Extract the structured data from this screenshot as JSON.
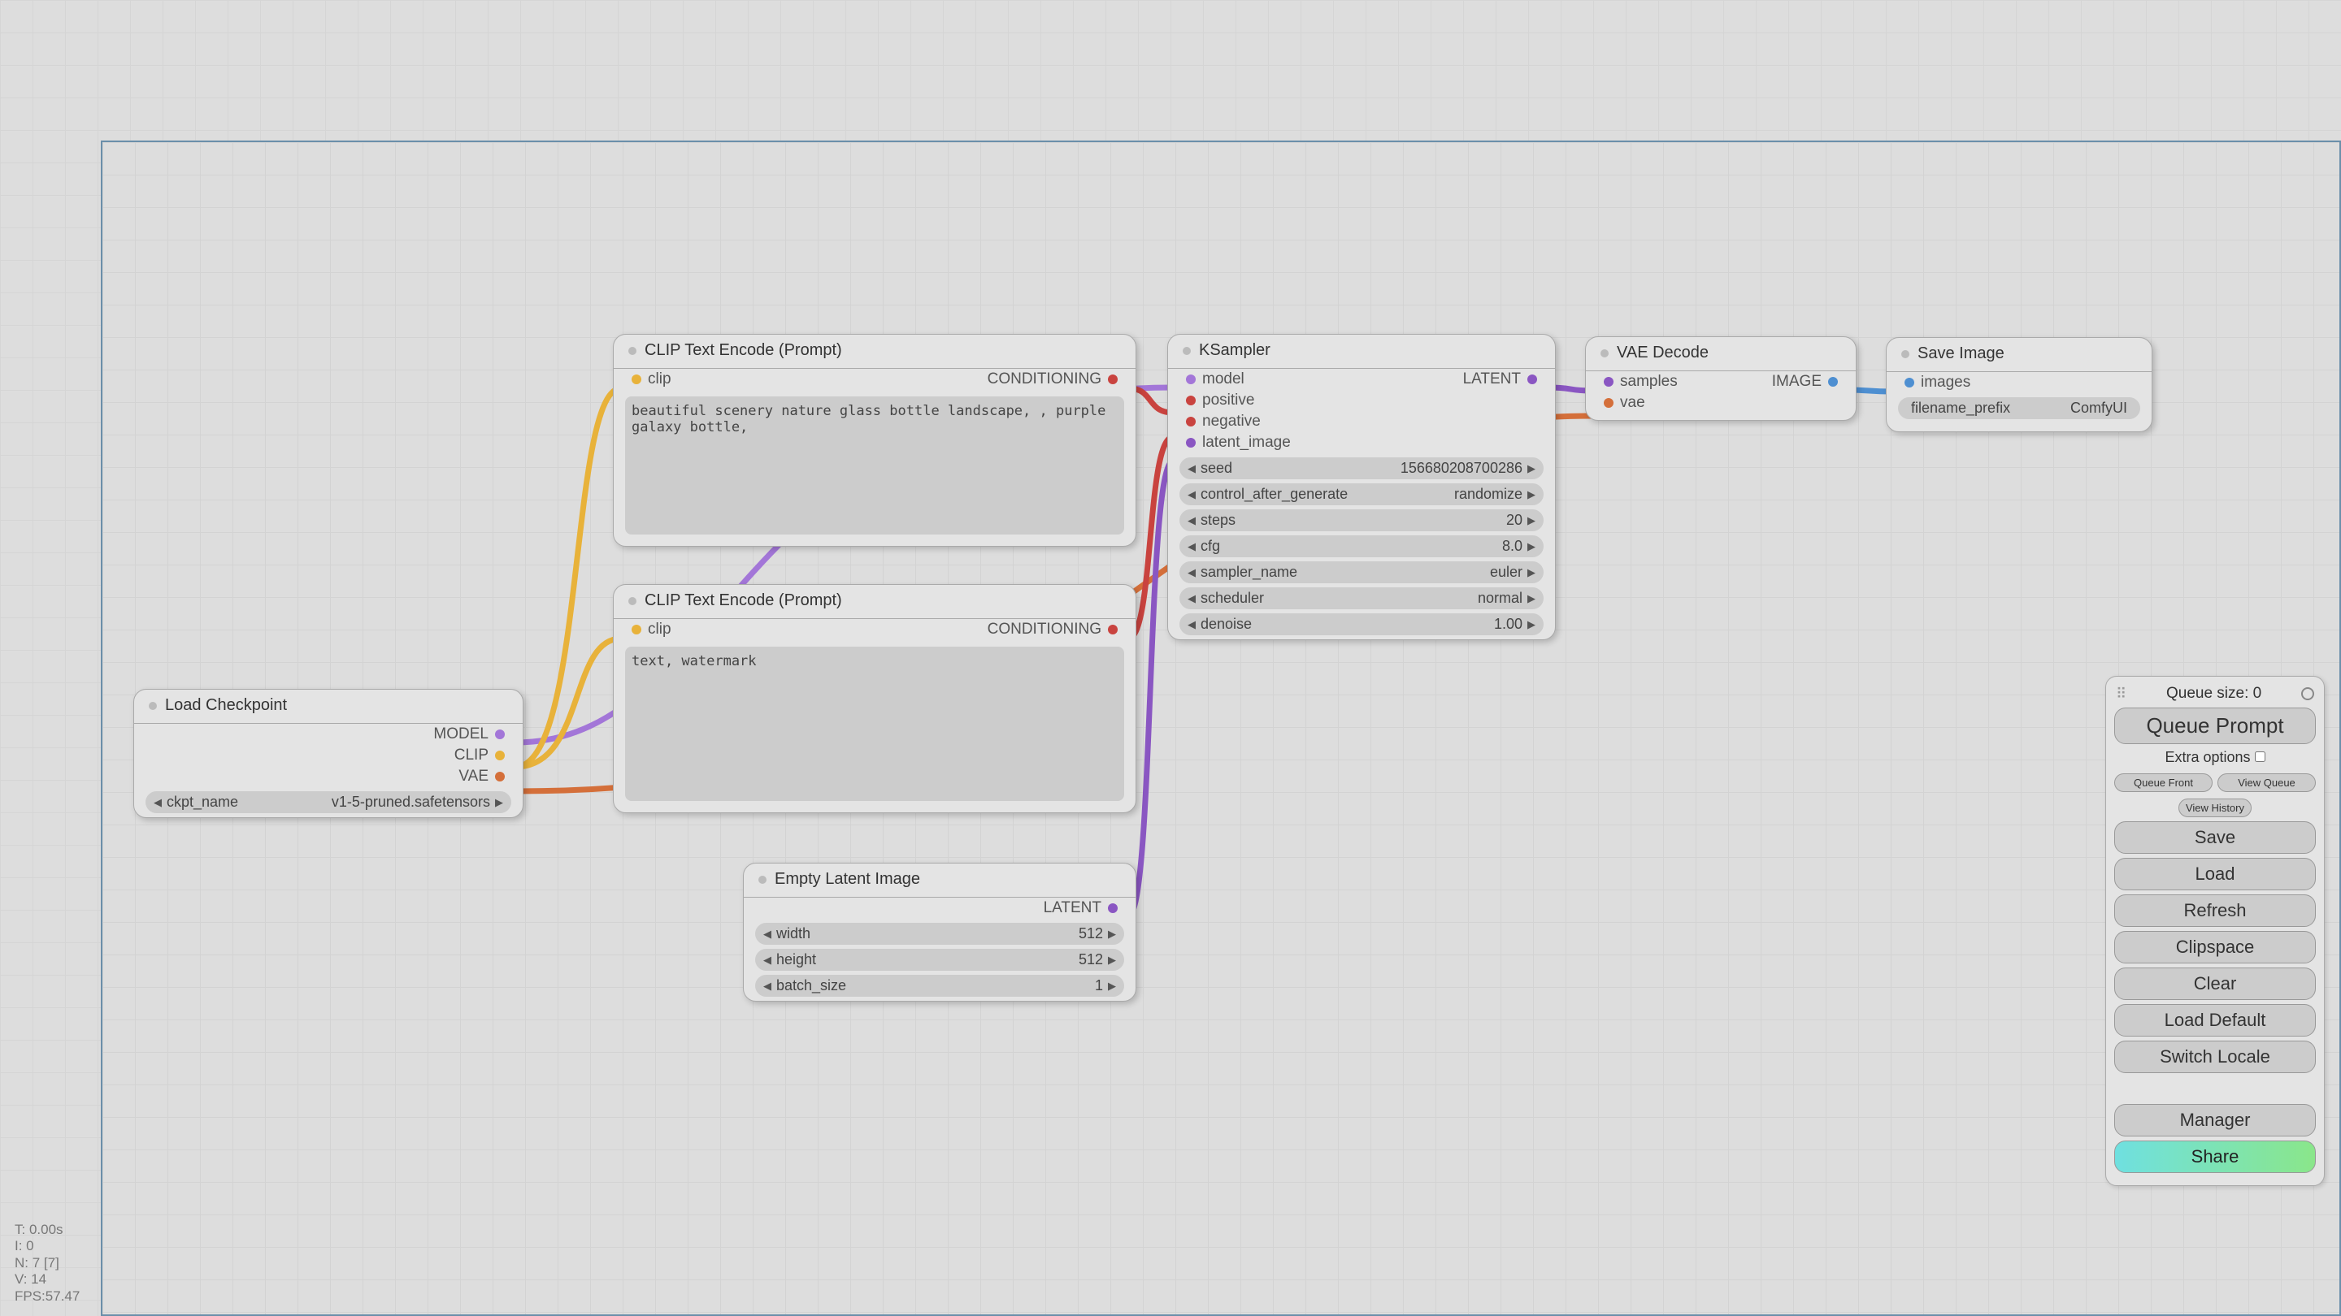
{
  "nodes": {
    "load_ckpt": {
      "title": "Load Checkpoint",
      "outputs": {
        "model": "MODEL",
        "clip": "CLIP",
        "vae": "VAE"
      },
      "ckpt_name": {
        "label": "ckpt_name",
        "value": "v1-5-pruned.safetensors"
      }
    },
    "clip_pos": {
      "title": "CLIP Text Encode (Prompt)",
      "input": "clip",
      "output": "CONDITIONING",
      "text": "beautiful scenery nature glass bottle landscape, , purple galaxy bottle,"
    },
    "clip_neg": {
      "title": "CLIP Text Encode (Prompt)",
      "input": "clip",
      "output": "CONDITIONING",
      "text": "text, watermark"
    },
    "empty_latent": {
      "title": "Empty Latent Image",
      "output": "LATENT",
      "width": {
        "label": "width",
        "value": "512"
      },
      "height": {
        "label": "height",
        "value": "512"
      },
      "batch": {
        "label": "batch_size",
        "value": "1"
      }
    },
    "ksampler": {
      "title": "KSampler",
      "inputs": {
        "model": "model",
        "positive": "positive",
        "negative": "negative",
        "latent": "latent_image"
      },
      "output": "LATENT",
      "seed": {
        "label": "seed",
        "value": "156680208700286"
      },
      "cag": {
        "label": "control_after_generate",
        "value": "randomize"
      },
      "steps": {
        "label": "steps",
        "value": "20"
      },
      "cfg": {
        "label": "cfg",
        "value": "8.0"
      },
      "sampler": {
        "label": "sampler_name",
        "value": "euler"
      },
      "sched": {
        "label": "scheduler",
        "value": "normal"
      },
      "denoise": {
        "label": "denoise",
        "value": "1.00"
      }
    },
    "vae_decode": {
      "title": "VAE Decode",
      "inputs": {
        "samples": "samples",
        "vae": "vae"
      },
      "output": "IMAGE"
    },
    "save_image": {
      "title": "Save Image",
      "input": "images",
      "prefix": {
        "label": "filename_prefix",
        "value": "ComfyUI"
      }
    }
  },
  "panel": {
    "queue_size_label": "Queue size: 0",
    "queue_prompt": "Queue Prompt",
    "extra_options": "Extra options",
    "queue_front": "Queue Front",
    "view_queue": "View Queue",
    "view_history": "View History",
    "save": "Save",
    "load": "Load",
    "refresh": "Refresh",
    "clipspace": "Clipspace",
    "clear": "Clear",
    "load_default": "Load Default",
    "switch_locale": "Switch Locale",
    "manager": "Manager",
    "share": "Share"
  },
  "stats": {
    "t": "T: 0.00s",
    "i": "I: 0",
    "n": "N: 7 [7]",
    "v": "V: 14",
    "fps": "FPS:57.47"
  }
}
